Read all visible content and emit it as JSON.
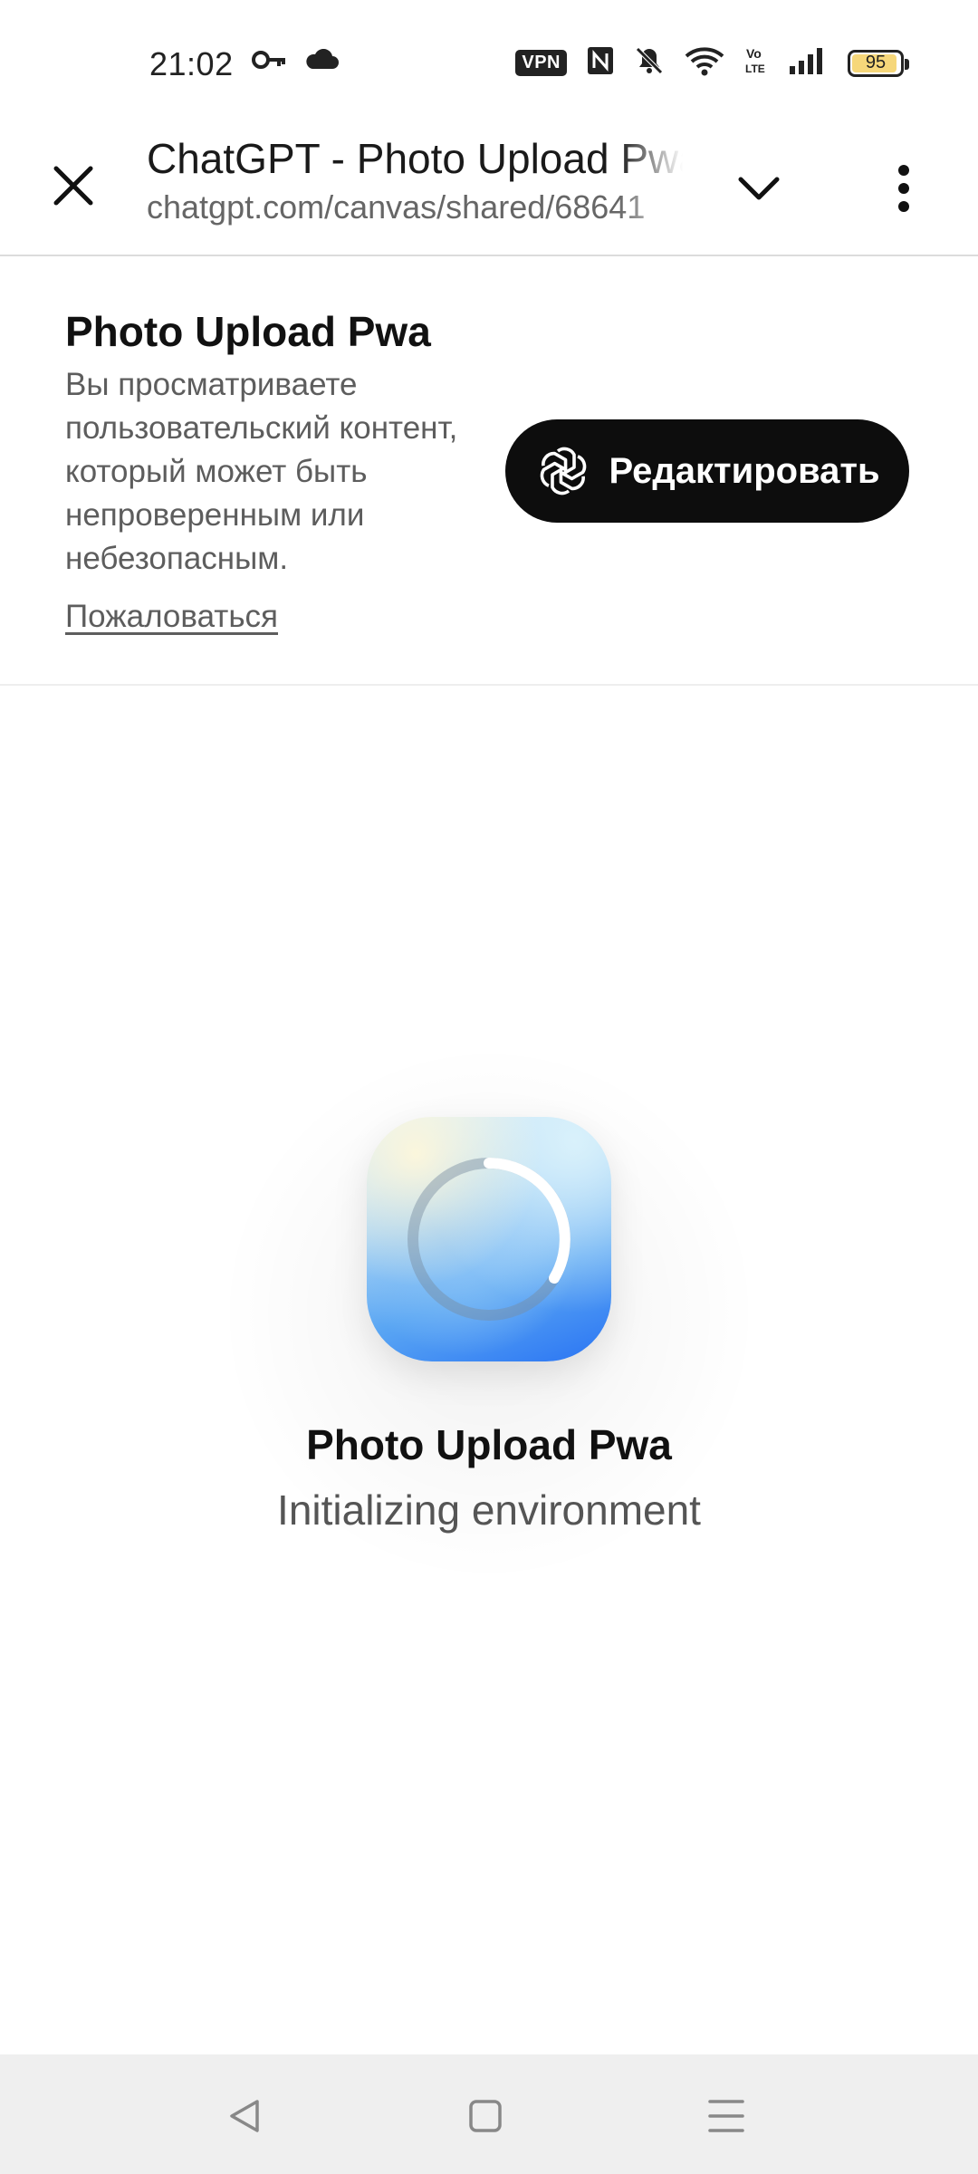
{
  "status_bar": {
    "time": "21:02",
    "icons": [
      "key-icon",
      "cloud-icon",
      "vpn-badge",
      "nfc-icon",
      "mute-icon",
      "wifi-icon",
      "volte-icon",
      "signal-icon",
      "battery-icon"
    ],
    "vpn_label": "VPN",
    "volte_label": "Vo LTE",
    "battery_level": "95",
    "battery_fraction": 0.95,
    "battery_color": "#f6d77a"
  },
  "browser_toolbar": {
    "title": "ChatGPT - Photo Upload Pwa",
    "url": "chatgpt.com/canvas/shared/68641",
    "close_icon": "close-icon",
    "expand_icon": "chevron-down-icon",
    "menu_icon": "more-vertical-icon"
  },
  "notice": {
    "title": "Photo Upload Pwa",
    "text": "Вы просматриваете пользовательский контент, который может быть непроверенным или небезопасным.",
    "report_link": "Пожаловаться",
    "edit_button_label": "Редактировать",
    "edit_button_icon": "openai-logo-icon"
  },
  "loading": {
    "app_name": "Photo Upload Pwa",
    "status": "Initializing environment",
    "icon": "app-icon-loading-spinner"
  },
  "nav_bar": {
    "icons": [
      "back-triangle-icon",
      "home-square-icon",
      "recents-menu-icon"
    ],
    "background": "#efefef"
  }
}
